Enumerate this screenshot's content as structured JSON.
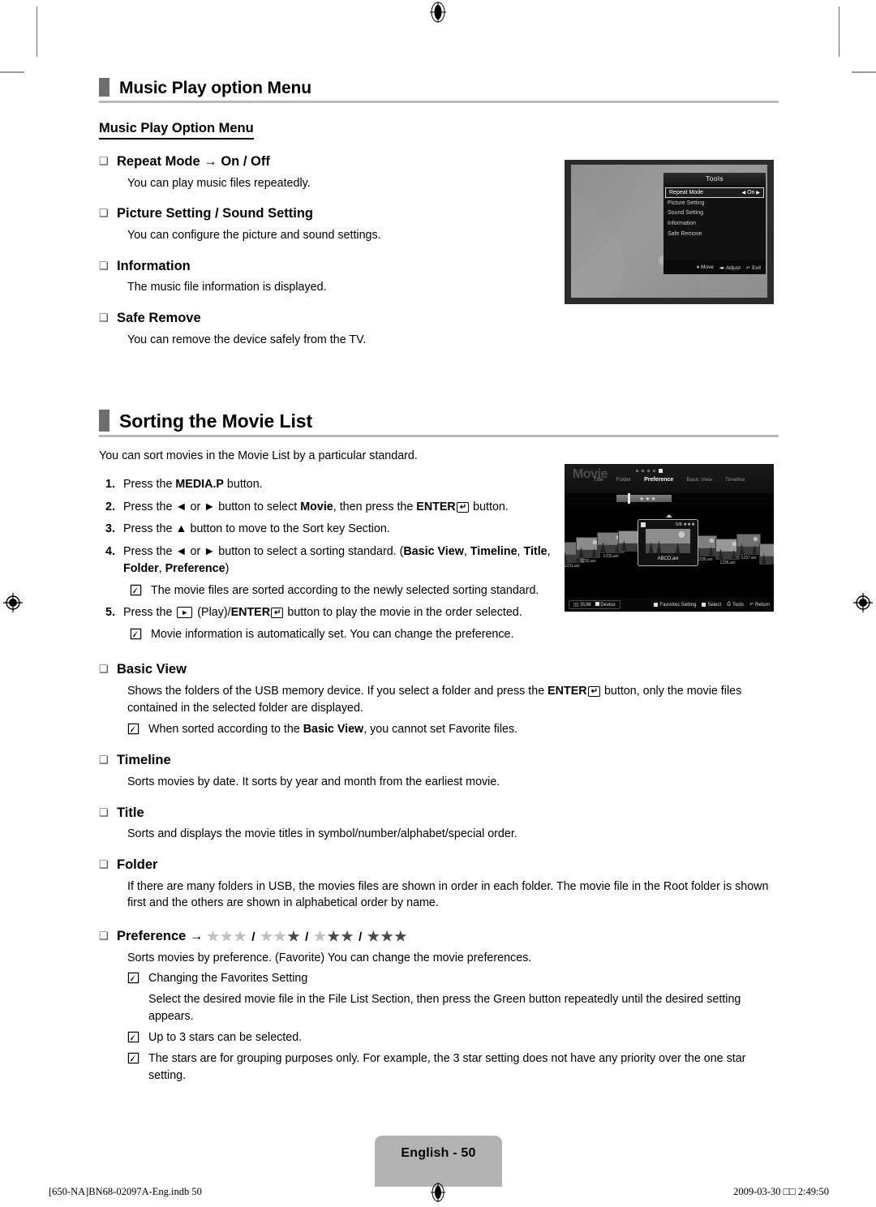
{
  "page": {
    "tab_label": "English - 50",
    "footer_left": "[650-NA]BN68-02097A-Eng.indb   50",
    "footer_right": "2009-03-30   □□ 2:49:50"
  },
  "section1": {
    "heading": "Music Play option Menu",
    "sub_heading": "Music Play Option Menu",
    "items": [
      {
        "title": "Repeat Mode → On / Off",
        "body": "You can play music files repeatedly."
      },
      {
        "title": "Picture Setting / Sound Setting",
        "body": "You can configure the picture and sound settings."
      },
      {
        "title": "Information",
        "body": "The music file information is displayed."
      },
      {
        "title": "Safe Remove",
        "body": "You can remove the device safely from the TV."
      }
    ],
    "screenshot": {
      "title": "Tools",
      "menu": [
        {
          "label": "Repeat Mode",
          "value": "On",
          "selected": true
        },
        {
          "label": "Picture Setting",
          "value": "",
          "selected": false
        },
        {
          "label": "Sound Setting",
          "value": "",
          "selected": false
        },
        {
          "label": "Information",
          "value": "",
          "selected": false
        },
        {
          "label": "Safe Remove",
          "value": "",
          "selected": false
        }
      ],
      "footer": [
        "Move",
        "Adjust",
        "Exit"
      ]
    }
  },
  "section2": {
    "heading": "Sorting the Movie List",
    "intro": "You can sort movies in the Movie List by a particular standard.",
    "steps": [
      {
        "num": "1.",
        "html": "Press the <b>MEDIA.P</b> button."
      },
      {
        "num": "2.",
        "html": "Press the ◄ or ► button to select <b>Movie</b>, then press the <b>ENTER</b><span class=\"enterkey\">↵</span> button."
      },
      {
        "num": "3.",
        "html": "Press the ▲ button to move to the Sort key Section."
      },
      {
        "num": "4.",
        "html": "Press the ◄ or ► button to select a sorting standard. (<b>Basic View</b>, <b>Timeline</b>, <b>Title</b>, <b>Folder</b>, <b>Preference</b>)"
      },
      {
        "num": "5.",
        "html": "Press the <span class=\"playkey\">►</span> (Play)/<b>ENTER</b><span class=\"enterkey\">↵</span> button to play the movie in the order selected."
      }
    ],
    "step_notes": {
      "after4": "The movie files are sorted according to the newly selected sorting standard.",
      "after5": "Movie information is automatically set. You can change the preference."
    },
    "items": [
      {
        "title": "Basic View",
        "body_html": "Shows the folders of the USB memory device. If you select a folder and press the <b>ENTER</b><span class=\"enterkey\">↵</span> button, only the movie files contained in the selected folder are displayed.",
        "note": "When sorted according to the <b>Basic View</b>, you cannot set Favorite files."
      },
      {
        "title": "Timeline",
        "body_html": "Sorts movies by date. It sorts by year and month from the earliest movie.",
        "note": ""
      },
      {
        "title": "Title",
        "body_html": "Sorts and displays the movie titles in symbol/number/alphabet/special order.",
        "note": ""
      },
      {
        "title": "Folder",
        "body_html": "If there are many folders in USB, the movies files are shown in order in each folder. The movie file in the Root folder is shown first and the others are shown in alphabetical order by name.",
        "note": ""
      }
    ],
    "preference": {
      "title_prefix": "Preference →",
      "star_groups": [
        0,
        1,
        2,
        3
      ],
      "stars_per_group": 3,
      "body": "Sorts movies by preference. (Favorite) You can change the movie preferences.",
      "notes": [
        "Changing the Favorites Setting",
        "Up to 3 stars can be selected.",
        "The stars are for grouping purposes only. For example, the 3 star setting does not have any priority over the one star setting."
      ],
      "note_sub": "Select the desired movie file in the File List Section, then press the Green button repeatedly until the desired setting appears."
    },
    "screenshot": {
      "logo": "Movie",
      "nav": [
        "Title",
        "Folder",
        "Preference",
        "Basic View",
        "Timeline"
      ],
      "nav_active": "Preference",
      "slider_stars": "★★★",
      "files": [
        "1231.avi",
        "1232.avi",
        "1233.avi",
        "1235.avi",
        "1236.avi",
        "1237.avi"
      ],
      "selected_file": "ABCD.avi",
      "selected_index_label": "5/8",
      "selected_stars": "★★★",
      "footer_left": [
        "SUM",
        "Device"
      ],
      "footer_right": [
        "Favorites Setting",
        "Select",
        "Tools",
        "Return"
      ]
    }
  },
  "colors": {
    "heading_bar": "#6e6e6e",
    "rule": "#b9b9b9",
    "tab": "#b3b3b3",
    "star_off": "#c0c0c0",
    "star_on": "#4a4a4a"
  }
}
